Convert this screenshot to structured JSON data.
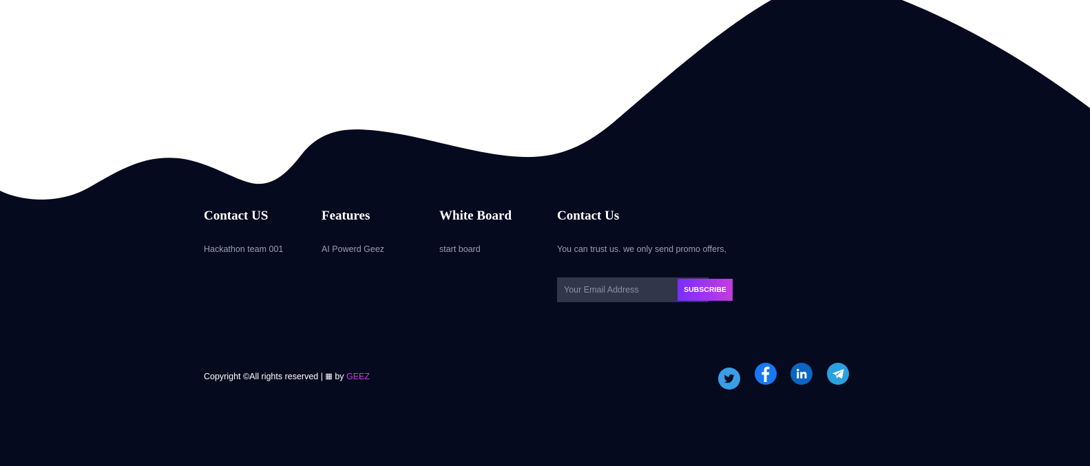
{
  "footer": {
    "columns": [
      {
        "heading": "Contact US",
        "text": "Hackathon team 001"
      },
      {
        "heading": "Features",
        "text": "AI Powerd Geez"
      },
      {
        "heading": "White Board",
        "text": "start board"
      },
      {
        "heading": "Contact Us",
        "text": "You can trust us. we only send promo offers,"
      }
    ],
    "newsletter": {
      "email_placeholder": "Your Email Address",
      "email_value": "",
      "subscribe_label": "SUBSCRIBE"
    },
    "copyright": {
      "prefix": "Copyright ©All rights reserved |",
      "icon": "grid-icon",
      "by": "by",
      "brand": "GEEZ"
    },
    "social": [
      {
        "name": "twitter",
        "icon": "twitter-icon",
        "color": "#3a9de8"
      },
      {
        "name": "facebook",
        "icon": "facebook-icon",
        "color": "#1877f2"
      },
      {
        "name": "linkedin",
        "icon": "linkedin-icon",
        "color": "#0a66c2"
      },
      {
        "name": "telegram",
        "icon": "telegram-icon",
        "color": "#2aa1e0"
      }
    ]
  },
  "colors": {
    "background": "#ffffff",
    "footer_background": "#050a1e",
    "muted_text": "#9a9fb6",
    "accent_gradient_start": "#7a2dff",
    "accent_gradient_end": "#c63bdf",
    "brand": "#c43ed6"
  }
}
